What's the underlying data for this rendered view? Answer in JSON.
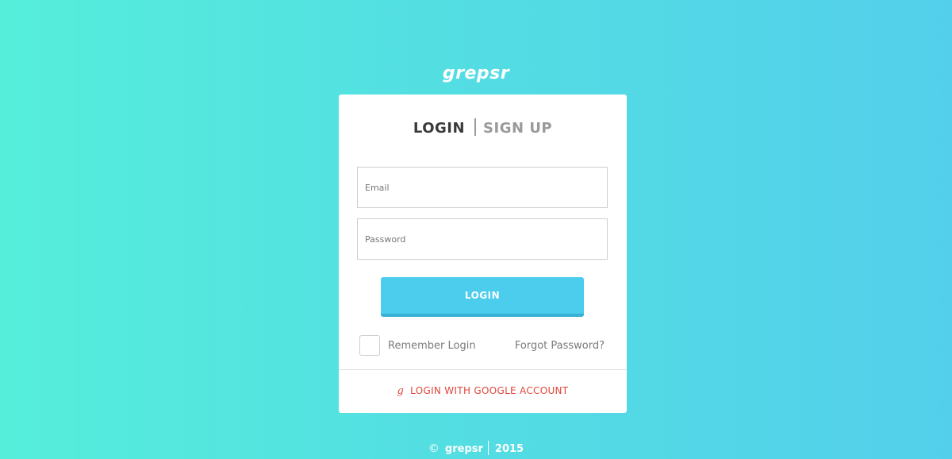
{
  "brand": {
    "logo_text": "grepsr"
  },
  "tabs": {
    "login_label": "LOGIN",
    "signup_label": "SIGN UP"
  },
  "form": {
    "email_placeholder": "Email",
    "password_placeholder": "Password",
    "login_button_label": "LOGIN",
    "remember_label": "Remember Login",
    "forgot_label": "Forgot Password?"
  },
  "google": {
    "icon_glyph": "g",
    "label": "LOGIN WITH GOOGLE ACCOUNT"
  },
  "footer": {
    "copyright_glyph": "©",
    "brand": "grepsr",
    "year": "2015"
  },
  "colors": {
    "background_start": "#55eedb",
    "background_end": "#53cfeb",
    "button": "#4ccdee",
    "google_red": "#e0463b"
  }
}
